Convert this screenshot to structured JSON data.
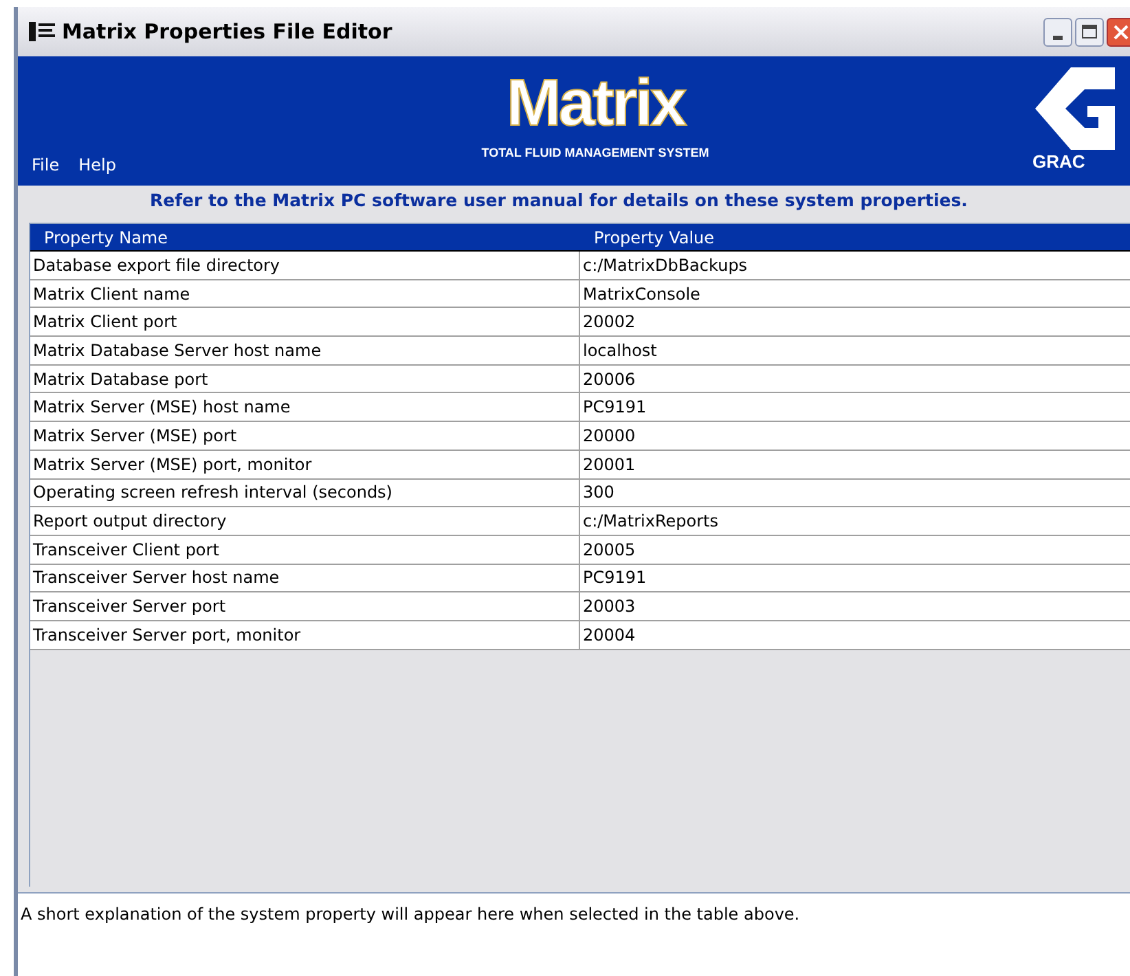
{
  "window": {
    "title": "Matrix Properties File Editor"
  },
  "menu": [
    "File",
    "Help"
  ],
  "banner": {
    "logo": "Matrix",
    "tagline": "TOTAL FLUID MANAGEMENT SYSTEM",
    "brand": "GRAC"
  },
  "notice": "Refer to the Matrix PC software user manual for details on these system properties.",
  "table": {
    "columns": [
      "Property Name",
      "Property Value"
    ],
    "rows": [
      [
        "Database export file directory",
        "c:/MatrixDbBackups"
      ],
      [
        "Matrix Client name",
        "MatrixConsole"
      ],
      [
        "Matrix Client port",
        "20002"
      ],
      [
        "Matrix Database Server host name",
        "localhost"
      ],
      [
        "Matrix Database port",
        "20006"
      ],
      [
        "Matrix Server (MSE) host name",
        "PC9191"
      ],
      [
        "Matrix Server (MSE) port",
        "20000"
      ],
      [
        "Matrix Server (MSE) port, monitor",
        "20001"
      ],
      [
        "Operating screen refresh interval (seconds)",
        "300"
      ],
      [
        "Report output directory",
        "c:/MatrixReports"
      ],
      [
        "Transceiver Client port",
        "20005"
      ],
      [
        "Transceiver Server host name",
        "PC9191"
      ],
      [
        "Transceiver Server port",
        "20003"
      ],
      [
        "Transceiver Server port, monitor",
        "20004"
      ]
    ]
  },
  "description": "A short explanation of the system property will appear here when selected in the table above."
}
